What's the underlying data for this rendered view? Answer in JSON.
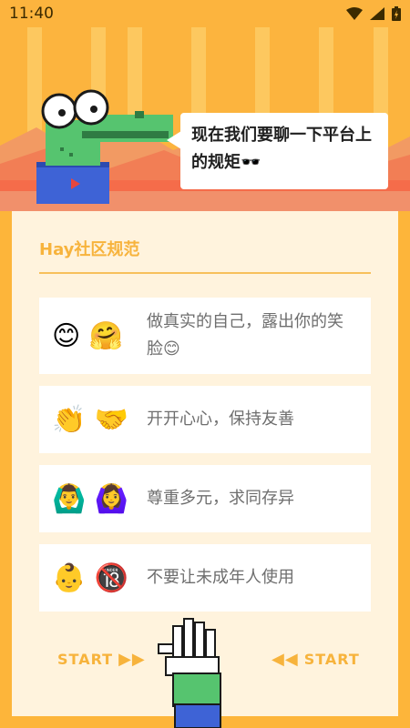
{
  "status_bar": {
    "time": "11:40"
  },
  "speech": {
    "text": "现在我们要聊一下平台上的规矩🕶️"
  },
  "card": {
    "title": "Hay社区规范",
    "rules": [
      {
        "emojis": "😊 🤗",
        "text": "做真实的自己，露出你的笑脸😊"
      },
      {
        "emojis": "👏 🤝",
        "text": "开开心心，保持友善"
      },
      {
        "emojis": "🙆‍♂️ 🙆‍♀️",
        "text": "尊重多元，求同存异"
      },
      {
        "emojis": "👶 🔞",
        "text": "不要让未成年人使用"
      }
    ]
  },
  "start_left": {
    "label": "START"
  },
  "start_right": {
    "label": "START"
  },
  "colors": {
    "accent": "#F7B33C",
    "background": "#FDB53A",
    "card": "#FFF3DD"
  }
}
